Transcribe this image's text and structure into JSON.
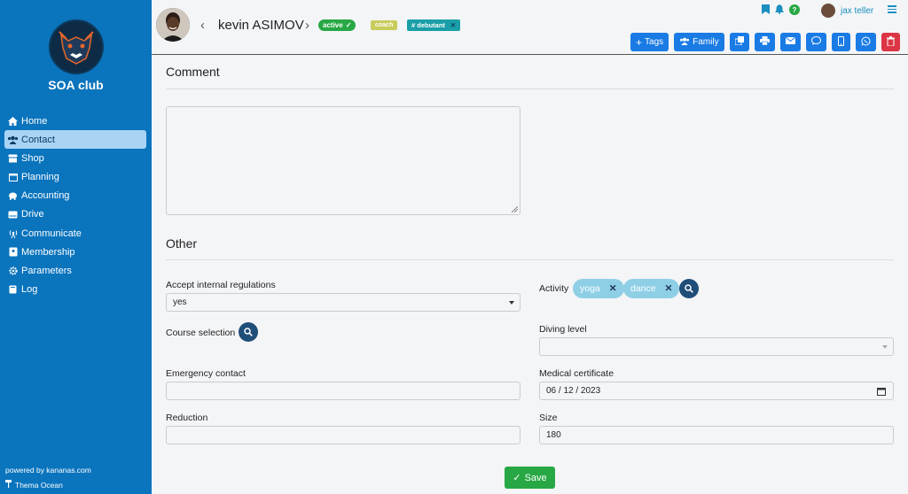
{
  "sidebar": {
    "club_name": "SOA club",
    "items": [
      {
        "label": "Home",
        "icon": "home-icon"
      },
      {
        "label": "Contact",
        "icon": "users-icon"
      },
      {
        "label": "Shop",
        "icon": "shop-icon"
      },
      {
        "label": "Planning",
        "icon": "calendar-icon"
      },
      {
        "label": "Accounting",
        "icon": "piggy-bank-icon"
      },
      {
        "label": "Drive",
        "icon": "drive-icon"
      },
      {
        "label": "Communicate",
        "icon": "broadcast-icon"
      },
      {
        "label": "Membership",
        "icon": "id-card-icon"
      },
      {
        "label": "Parameters",
        "icon": "gear-icon"
      },
      {
        "label": "Log",
        "icon": "book-icon"
      }
    ],
    "active_item": "Contact",
    "powered_by": "powered by kananas.com",
    "theme": "Thema Ocean"
  },
  "header": {
    "contact_name": "kevin ASIMOV",
    "status_badge": "active",
    "role_badge": "coach",
    "tag_badge": "# debutant",
    "user_name": "jax teller",
    "toolbar": {
      "tags_label": "Tags",
      "family_label": "Family"
    }
  },
  "comment": {
    "title": "Comment",
    "value": ""
  },
  "other": {
    "title": "Other",
    "accept_label": "Accept internal regulations",
    "accept_value": "yes",
    "activity_label": "Activity",
    "activities": [
      "yoga",
      "dance"
    ],
    "course_label": "Course selection",
    "diving_label": "Diving level",
    "diving_value": "",
    "emergency_label": "Emergency contact",
    "emergency_value": "",
    "medical_label": "Medical certificate",
    "medical_value": "06 / 12 / 2023",
    "reduction_label": "Reduction",
    "reduction_value": "",
    "size_label": "Size",
    "size_value": "180"
  },
  "save_label": "Save",
  "colors": {
    "sidebar_bg": "#0a74bd",
    "primary": "#1a7be5",
    "success": "#27a844",
    "danger": "#dc3545",
    "pill": "#8ecfe6"
  }
}
